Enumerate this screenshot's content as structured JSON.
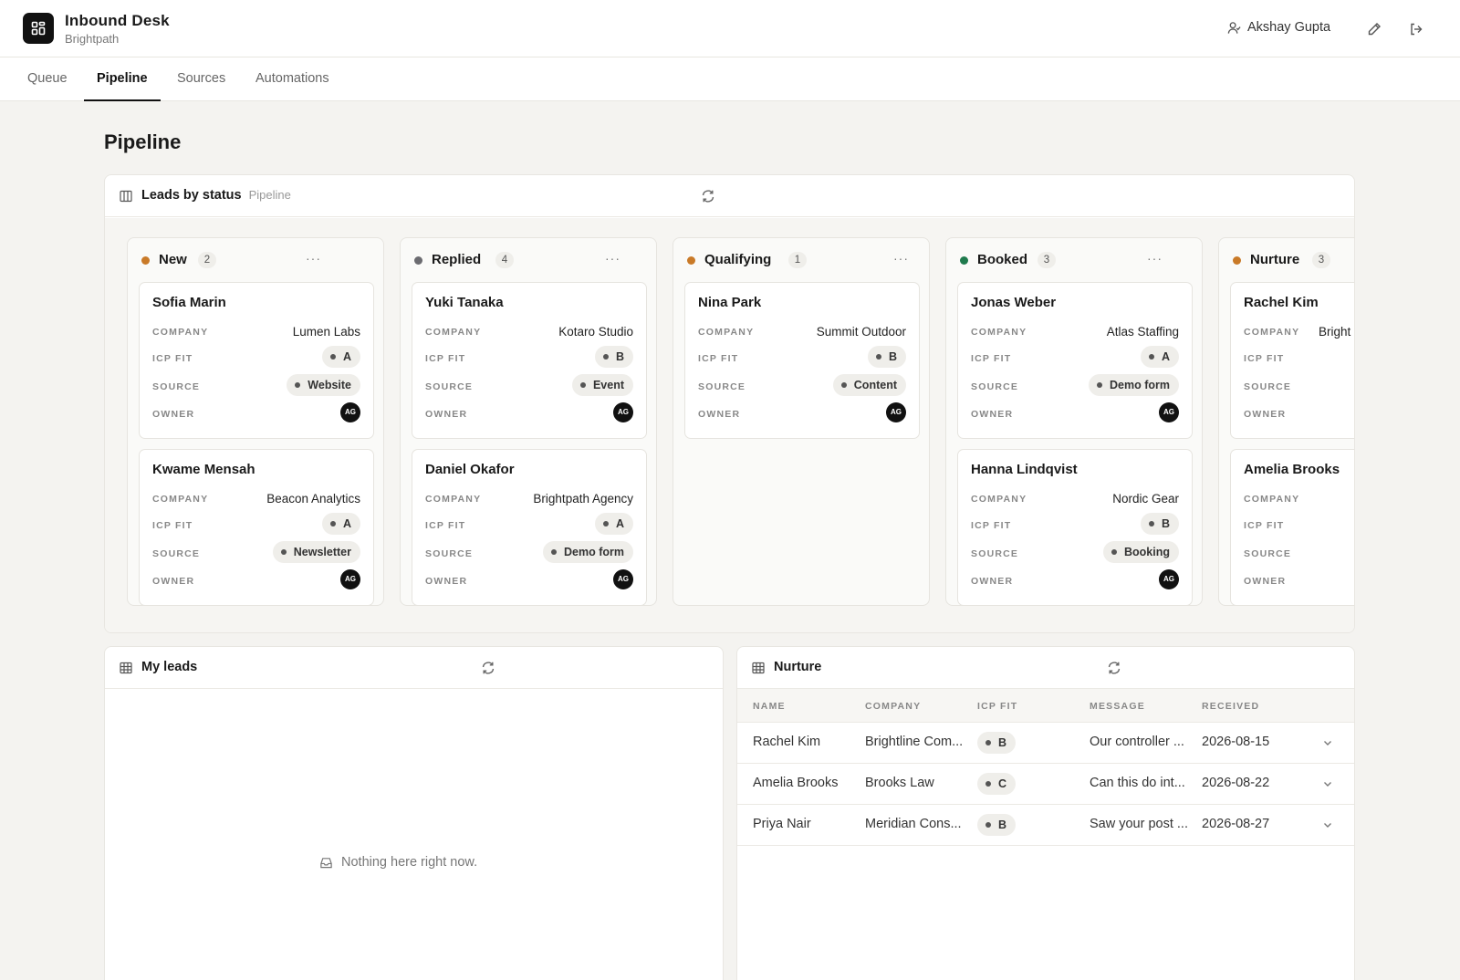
{
  "app": {
    "title": "Inbound Desk",
    "subtitle": "Brightpath"
  },
  "header": {
    "user_name": "Akshay Gupta"
  },
  "tabs": [
    {
      "label": "Queue"
    },
    {
      "label": "Pipeline",
      "active": true
    },
    {
      "label": "Sources"
    },
    {
      "label": "Automations"
    }
  ],
  "page": {
    "title": "Pipeline"
  },
  "board": {
    "title": "Leads by status",
    "subtitle": "Pipeline",
    "labels": {
      "company": "COMPANY",
      "icp_fit": "ICP FIT",
      "source": "SOURCE",
      "owner": "OWNER"
    },
    "columns": [
      {
        "name": "New",
        "count": "2",
        "dot_color": "#c97a28",
        "more": "···",
        "cards": [
          {
            "name": "Sofia Marin",
            "company": "Lumen Labs",
            "icp": "A",
            "source": "Website",
            "owner": "AG"
          },
          {
            "name": "Kwame Mensah",
            "company": "Beacon Analytics",
            "icp": "A",
            "source": "Newsletter",
            "owner": "AG"
          }
        ]
      },
      {
        "name": "Replied",
        "count": "4",
        "dot_color": "#6b6b70",
        "more": "···",
        "cards": [
          {
            "name": "Yuki Tanaka",
            "company": "Kotaro Studio",
            "icp": "B",
            "source": "Event",
            "owner": "AG"
          },
          {
            "name": "Daniel Okafor",
            "company": "Brightpath Agency",
            "icp": "A",
            "source": "Demo form",
            "owner": "AG"
          }
        ]
      },
      {
        "name": "Qualifying",
        "count": "1",
        "dot_color": "#c97a28",
        "more": "···",
        "cards": [
          {
            "name": "Nina Park",
            "company": "Summit Outdoor",
            "icp": "B",
            "source": "Content",
            "owner": "AG"
          }
        ]
      },
      {
        "name": "Booked",
        "count": "3",
        "dot_color": "#1f7a4d",
        "more": "···",
        "cards": [
          {
            "name": "Jonas Weber",
            "company": "Atlas Staffing",
            "icp": "A",
            "source": "Demo form",
            "owner": "AG"
          },
          {
            "name": "Hanna Lindqvist",
            "company": "Nordic Gear",
            "icp": "B",
            "source": "Booking",
            "owner": "AG"
          }
        ]
      },
      {
        "name": "Nurture",
        "count": "3",
        "dot_color": "#c97a28",
        "more": "···",
        "cards": [
          {
            "name": "Rachel Kim",
            "company": "Bright",
            "icp": "",
            "source": "",
            "owner": ""
          },
          {
            "name": "Amelia Brooks",
            "company": "",
            "icp": "",
            "source": "",
            "owner": ""
          }
        ]
      }
    ]
  },
  "my_leads": {
    "title": "My leads",
    "empty_text": "Nothing here right now."
  },
  "nurture": {
    "title": "Nurture",
    "columns": [
      "NAME",
      "COMPANY",
      "ICP FIT",
      "MESSAGE",
      "RECEIVED"
    ],
    "rows": [
      {
        "name": "Rachel Kim",
        "company": "Brightline Com...",
        "icp": "B",
        "message": "Our controller ...",
        "received": "2026-08-15"
      },
      {
        "name": "Amelia Brooks",
        "company": "Brooks Law",
        "icp": "C",
        "message": "Can this do int...",
        "received": "2026-08-22"
      },
      {
        "name": "Priya Nair",
        "company": "Meridian Cons...",
        "icp": "B",
        "message": "Saw your post ...",
        "received": "2026-08-27"
      }
    ]
  }
}
